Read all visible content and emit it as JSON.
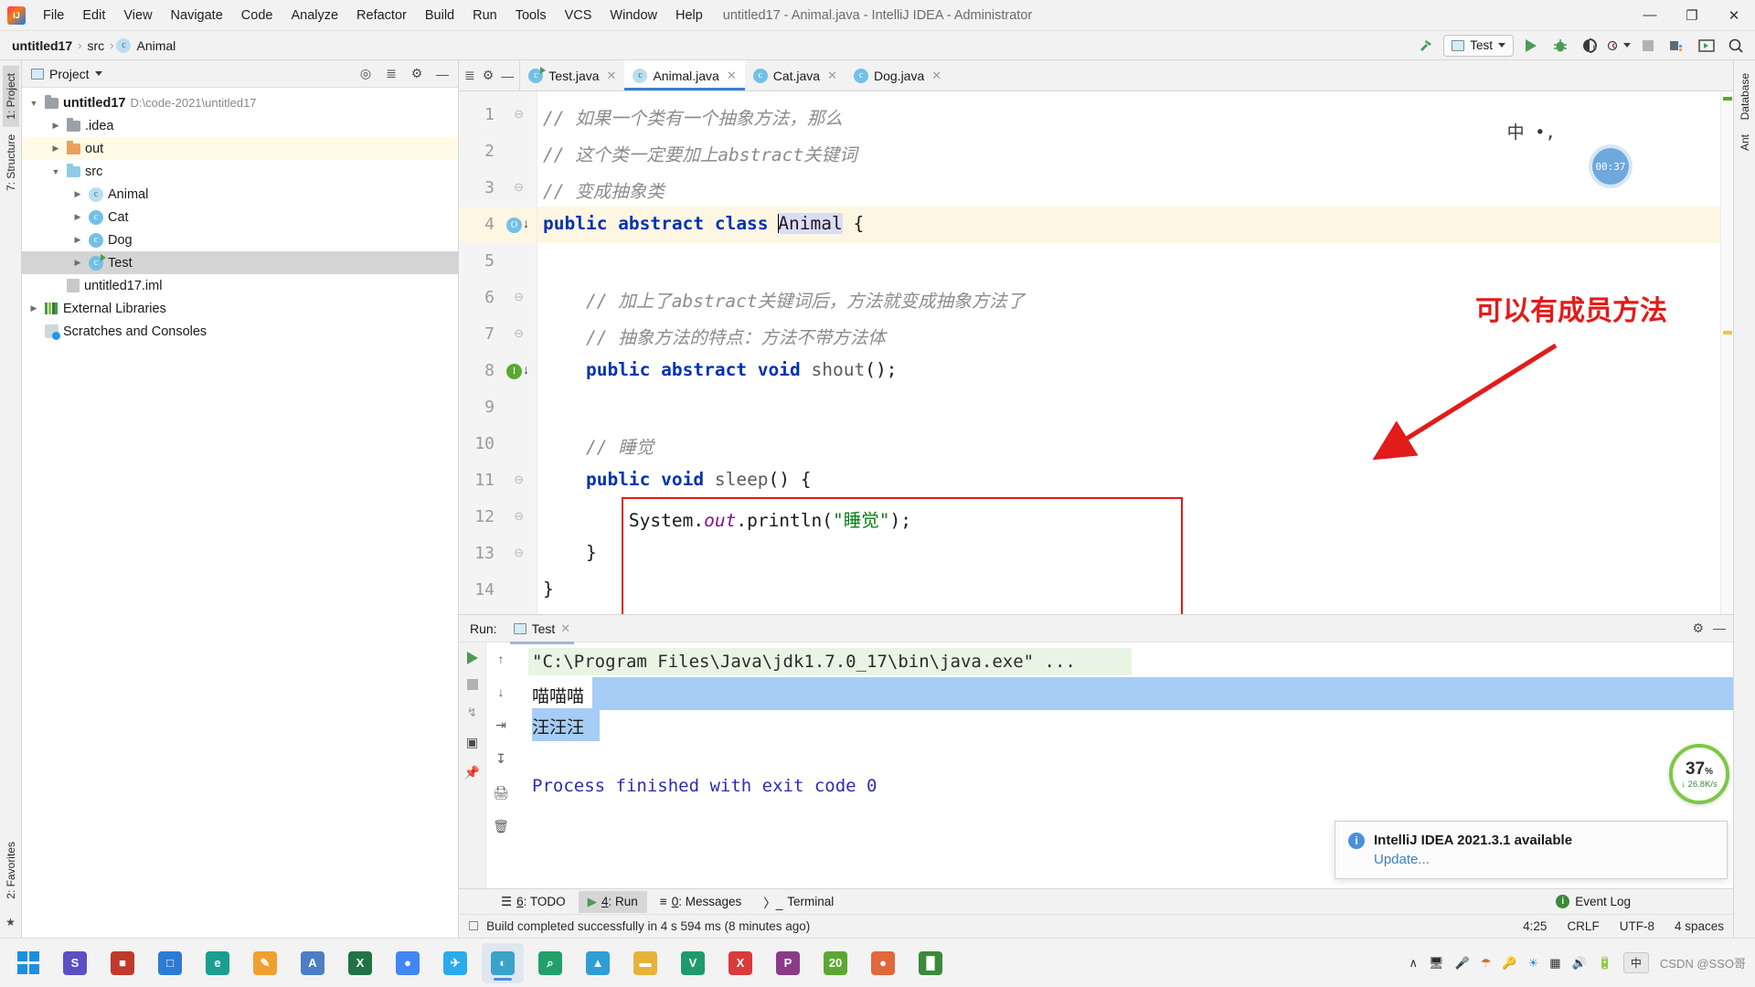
{
  "window": {
    "title": "untitled17 - Animal.java - IntelliJ IDEA - Administrator",
    "minimize": "—",
    "maximize": "❐",
    "close": "✕"
  },
  "menu": {
    "items": [
      {
        "label": "File"
      },
      {
        "label": "Edit"
      },
      {
        "label": "View"
      },
      {
        "label": "Navigate"
      },
      {
        "label": "Code"
      },
      {
        "label": "Analyze"
      },
      {
        "label": "Refactor"
      },
      {
        "label": "Build"
      },
      {
        "label": "Run"
      },
      {
        "label": "Tools"
      },
      {
        "label": "VCS"
      },
      {
        "label": "Window"
      },
      {
        "label": "Help"
      }
    ]
  },
  "navbar": {
    "breadcrumbs": [
      {
        "label": "untitled17"
      },
      {
        "sep": "›"
      },
      {
        "label": "src"
      },
      {
        "sep": "›"
      },
      {
        "label": "Animal"
      }
    ],
    "run_config": "Test",
    "icons": {
      "build": "build-hammer-icon",
      "run": "run-icon",
      "debug": "debug-icon",
      "run_coverage": "run-with-coverage-icon",
      "profiler": "profiler-icon",
      "stop": "stop-icon",
      "project_structure": "project-structure-icon",
      "updates": "updates-icon",
      "search": "search-everywhere-icon"
    }
  },
  "left_strips": [
    {
      "label": "1: Project",
      "active": true
    },
    {
      "label": "7: Structure",
      "active": false
    },
    {
      "label": "2: Favorites",
      "active": false
    }
  ],
  "right_strips": [
    {
      "label": "Database"
    },
    {
      "label": "Ant"
    }
  ],
  "project_panel": {
    "title": "Project",
    "dropdown": "▼",
    "tree": [
      {
        "indent": 0,
        "arrow": "▼",
        "icon": "module-folder",
        "label": "untitled17",
        "bold": true,
        "dim": "D:\\code-2021\\untitled17",
        "state": "normal"
      },
      {
        "indent": 1,
        "arrow": "▶",
        "icon": "folder-gray",
        "label": ".idea",
        "state": "normal"
      },
      {
        "indent": 1,
        "arrow": "▶",
        "icon": "folder-orange",
        "label": "out",
        "state": "highlight"
      },
      {
        "indent": 1,
        "arrow": "▼",
        "icon": "folder-blue",
        "label": "src",
        "state": "normal"
      },
      {
        "indent": 2,
        "arrow": "▶",
        "icon": "class-abstract",
        "label": "Animal",
        "state": "normal"
      },
      {
        "indent": 2,
        "arrow": "▶",
        "icon": "class",
        "label": "Cat",
        "state": "normal"
      },
      {
        "indent": 2,
        "arrow": "▶",
        "icon": "class",
        "label": "Dog",
        "state": "normal"
      },
      {
        "indent": 2,
        "arrow": "▶",
        "icon": "class-runnable",
        "label": "Test",
        "state": "selected"
      },
      {
        "indent": 1,
        "arrow": "",
        "icon": "iml-file",
        "label": "untitled17.iml",
        "state": "normal"
      },
      {
        "indent": 0,
        "arrow": "▶",
        "icon": "libraries",
        "label": "External Libraries",
        "state": "normal"
      },
      {
        "indent": 0,
        "arrow": "",
        "icon": "scratches",
        "label": "Scratches and Consoles",
        "state": "normal"
      }
    ]
  },
  "editor": {
    "tabs": [
      {
        "label": "Test.java",
        "icon": "class-runnable",
        "active": false
      },
      {
        "label": "Animal.java",
        "icon": "class-abstract",
        "active": true
      },
      {
        "label": "Cat.java",
        "icon": "class",
        "active": false
      },
      {
        "label": "Dog.java",
        "icon": "class",
        "active": false
      }
    ],
    "lines": [
      {
        "no": "1",
        "fold": "⊖",
        "gutter": "",
        "highlight": false,
        "segments": [
          {
            "t": "// ",
            "c": "cmt"
          },
          {
            "t": "如果一个类有一个抽象方法，那么",
            "c": "cmt"
          }
        ]
      },
      {
        "no": "2",
        "fold": "",
        "gutter": "",
        "highlight": false,
        "segments": [
          {
            "t": "// ",
            "c": "cmt"
          },
          {
            "t": "这个类一定要加上abstract关键词",
            "c": "cmt"
          }
        ]
      },
      {
        "no": "3",
        "fold": "⊖",
        "gutter": "",
        "highlight": false,
        "segments": [
          {
            "t": "// ",
            "c": "cmt"
          },
          {
            "t": "变成抽象类",
            "c": "cmt"
          }
        ]
      },
      {
        "no": "4",
        "fold": "",
        "gutter": "class-marker",
        "highlight": true,
        "segments": [
          {
            "t": "public abstract class ",
            "c": "kw"
          },
          {
            "t": "Animal",
            "c": "sel-token"
          },
          {
            "t": " {",
            "c": "ident"
          }
        ]
      },
      {
        "no": "5",
        "fold": "",
        "gutter": "",
        "highlight": false,
        "segments": []
      },
      {
        "no": "6",
        "fold": "⊖",
        "gutter": "",
        "highlight": false,
        "segments": [
          {
            "t": "    // ",
            "c": "cmt"
          },
          {
            "t": "加上了abstract关键词后，方法就变成抽象方法了",
            "c": "cmt"
          }
        ]
      },
      {
        "no": "7",
        "fold": "⊖",
        "gutter": "",
        "highlight": false,
        "segments": [
          {
            "t": "    // ",
            "c": "cmt"
          },
          {
            "t": "抽象方法的特点：方法不带方法体",
            "c": "cmt"
          }
        ]
      },
      {
        "no": "8",
        "fold": "",
        "gutter": "impl-marker",
        "highlight": false,
        "segments": [
          {
            "t": "    public abstract void ",
            "c": "kw"
          },
          {
            "t": "shout",
            "c": "fn"
          },
          {
            "t": "();",
            "c": "ident"
          }
        ]
      },
      {
        "no": "9",
        "fold": "",
        "gutter": "",
        "highlight": false,
        "segments": []
      },
      {
        "no": "10",
        "fold": "",
        "gutter": "",
        "highlight": false,
        "segments": [
          {
            "t": "    // ",
            "c": "cmt"
          },
          {
            "t": "睡觉",
            "c": "cmt"
          }
        ]
      },
      {
        "no": "11",
        "fold": "⊖",
        "gutter": "",
        "highlight": false,
        "segments": [
          {
            "t": "    public void ",
            "c": "kw"
          },
          {
            "t": "sleep",
            "c": "fn"
          },
          {
            "t": "() {",
            "c": "ident"
          }
        ]
      },
      {
        "no": "12",
        "fold": "⊖",
        "gutter": "",
        "highlight": false,
        "segments": [
          {
            "t": "        System.",
            "c": "ident"
          },
          {
            "t": "out",
            "c": "fld"
          },
          {
            "t": ".println(",
            "c": "ident"
          },
          {
            "t": "\"睡觉\"",
            "c": "str"
          },
          {
            "t": ");",
            "c": "ident"
          }
        ]
      },
      {
        "no": "13",
        "fold": "⊖",
        "gutter": "",
        "highlight": false,
        "segments": [
          {
            "t": "    }",
            "c": "ident"
          }
        ]
      },
      {
        "no": "14",
        "fold": "",
        "gutter": "",
        "highlight": false,
        "segments": [
          {
            "t": "}",
            "c": "ident"
          }
        ]
      }
    ],
    "annotation": "可以有成员方法",
    "ime_indicator": "中 •,",
    "timer_bubble": "00:37"
  },
  "run_panel": {
    "label": "Run:",
    "tab": "Test",
    "console_lines": [
      {
        "text": "\"C:\\Program Files\\Java\\jdk1.7.0_17\\bin\\java.exe\" ...",
        "style": "command"
      },
      {
        "text": "喵喵喵",
        "style": "output"
      },
      {
        "text": "汪汪汪",
        "style": "output-selected"
      },
      {
        "text": "",
        "style": "output"
      },
      {
        "text": "Process finished with exit code 0",
        "style": "result"
      }
    ],
    "side_icons": [
      "rerun-icon",
      "stop-icon",
      "thread-dump-icon",
      "layout-icon",
      "pin-icon"
    ],
    "side_icons2": [
      "up-arrow-icon",
      "down-arrow-icon",
      "soft-wrap-icon",
      "scroll-to-end-icon",
      "print-icon",
      "trash-icon"
    ],
    "header_icons": [
      "settings-gear-icon",
      "hide-icon"
    ]
  },
  "tool_windows": [
    {
      "num": "6",
      "label": ": TODO",
      "icon": "todo-icon",
      "active": false
    },
    {
      "num": "4",
      "label": ": Run",
      "icon": "run-icon",
      "active": true
    },
    {
      "num": "0",
      "label": ": Messages",
      "icon": "messages-icon",
      "active": false
    },
    {
      "num": "",
      "label": "Terminal",
      "icon": "terminal-icon",
      "active": false
    }
  ],
  "status_bar": {
    "message": "Build completed successfully in 4 s 594 ms (8 minutes ago)",
    "caret": "4:25",
    "line_sep": "CRLF",
    "encoding": "UTF-8",
    "indent": "4 spaces",
    "event_log": "Event Log"
  },
  "notification": {
    "title": "IntelliJ IDEA 2021.3.1 available",
    "link": "Update..."
  },
  "speed_widget": {
    "percent": "37",
    "percent_unit": "%",
    "rate": "↓ 26.8K/s"
  },
  "taskbar": {
    "apps": [
      {
        "name": "snipaste-app",
        "color": "#5a4fc4",
        "glyph": "S"
      },
      {
        "name": "recorder-app",
        "color": "#c0392b",
        "glyph": "■"
      },
      {
        "name": "bluestacks-app",
        "color": "#2b7bd6",
        "glyph": "□"
      },
      {
        "name": "edge-browser",
        "color": "#1a9e8f",
        "glyph": "e"
      },
      {
        "name": "notes-app",
        "color": "#f0a030",
        "glyph": "✎"
      },
      {
        "name": "explorer-blue-app",
        "color": "#4b7fc4",
        "glyph": "A"
      },
      {
        "name": "excel-app",
        "color": "#217346",
        "glyph": "X"
      },
      {
        "name": "chrome-browser",
        "color": "#4285f4",
        "glyph": "●"
      },
      {
        "name": "telegram-app",
        "color": "#2aabee",
        "glyph": "✈"
      },
      {
        "name": "browser-app",
        "color": "#3aa3c9",
        "glyph": "◐"
      },
      {
        "name": "search-app",
        "color": "#23a06a",
        "glyph": "⌕"
      },
      {
        "name": "idea-app",
        "color": "#2e9fd4",
        "glyph": "▲"
      },
      {
        "name": "file-explorer",
        "color": "#e8b23a",
        "glyph": "▬"
      },
      {
        "name": "video-app",
        "color": "#1f9a6d",
        "glyph": "V"
      },
      {
        "name": "xmind-app",
        "color": "#d93b3b",
        "glyph": "X"
      },
      {
        "name": "pdf-app",
        "color": "#8b3a8b",
        "glyph": "P"
      },
      {
        "name": "counter-app",
        "color": "#5aa832",
        "glyph": "20"
      },
      {
        "name": "firefox-app",
        "color": "#e0683a",
        "glyph": "●"
      },
      {
        "name": "chart-app",
        "color": "#3a8a3a",
        "glyph": "█"
      }
    ],
    "tray": {
      "expand": "∧",
      "icons": [
        "monitor-icon",
        "mic-icon",
        "shield-icon",
        "key-icon",
        "globe-icon",
        "grid-icon",
        "volume-icon",
        "battery-icon"
      ],
      "ime": "中",
      "watermark": "CSDN @SSO哥"
    }
  }
}
